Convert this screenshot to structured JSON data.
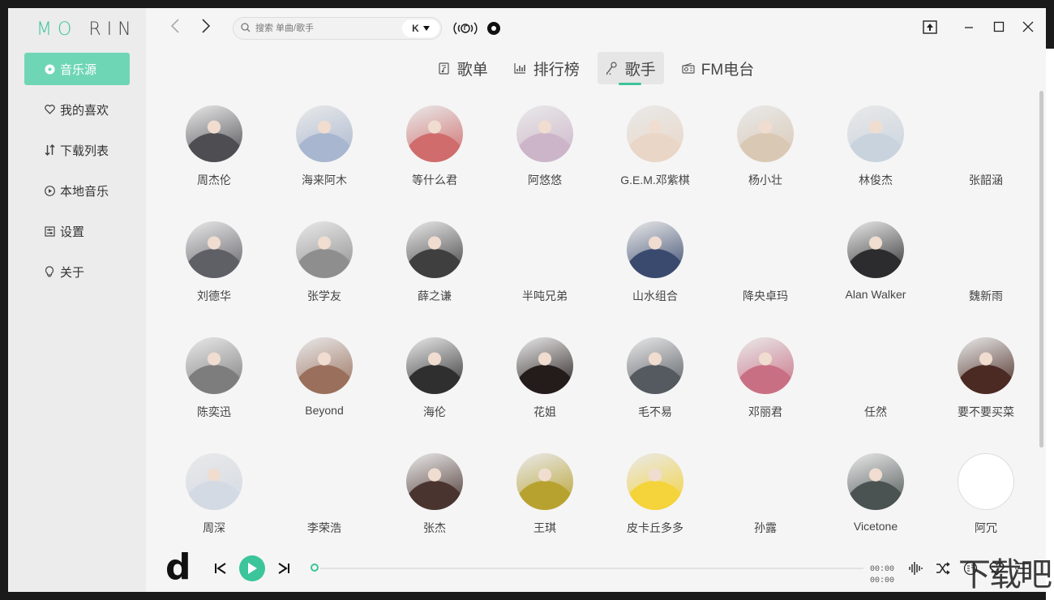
{
  "app": {
    "logo_left": "MO",
    "logo_right": "RIN"
  },
  "sidebar": {
    "items": [
      {
        "label": "音乐源",
        "icon": "disc-icon"
      },
      {
        "label": "我的喜欢",
        "icon": "heart-icon"
      },
      {
        "label": "下载列表",
        "icon": "sort-arrows-icon"
      },
      {
        "label": "本地音乐",
        "icon": "play-circle-icon"
      },
      {
        "label": "设置",
        "icon": "settings-icon"
      },
      {
        "label": "关于",
        "icon": "lightbulb-icon"
      }
    ]
  },
  "search": {
    "placeholder": "搜索 单曲/歌手",
    "source": "K"
  },
  "tabs": [
    {
      "label": "歌单",
      "icon": "playlist-icon"
    },
    {
      "label": "排行榜",
      "icon": "bar-chart-icon"
    },
    {
      "label": "歌手",
      "icon": "singer-icon"
    },
    {
      "label": "FM电台",
      "icon": "radio-icon"
    }
  ],
  "singers": [
    {
      "name": "周杰伦",
      "color": "#4d4d52",
      "has_avatar": true
    },
    {
      "name": "海来阿木",
      "color": "#a8b7cf",
      "has_avatar": true
    },
    {
      "name": "等什么君",
      "color": "#d06c6c",
      "has_avatar": true
    },
    {
      "name": "阿悠悠",
      "color": "#cdb5c9",
      "has_avatar": true
    },
    {
      "name": "G.E.M.邓紫棋",
      "color": "#e9d6c6",
      "has_avatar": true
    },
    {
      "name": "杨小壮",
      "color": "#d9c8b4",
      "has_avatar": true
    },
    {
      "name": "林俊杰",
      "color": "#c9d3de",
      "has_avatar": true
    },
    {
      "name": "张韶涵",
      "color": "",
      "has_avatar": false
    },
    {
      "name": "刘德华",
      "color": "#5f5f66",
      "has_avatar": true
    },
    {
      "name": "张学友",
      "color": "#8e8e8e",
      "has_avatar": true
    },
    {
      "name": "薛之谦",
      "color": "#3f3f3f",
      "has_avatar": true
    },
    {
      "name": "半吨兄弟",
      "color": "",
      "has_avatar": false
    },
    {
      "name": "山水组合",
      "color": "#3a4a6e",
      "has_avatar": true
    },
    {
      "name": "降央卓玛",
      "color": "",
      "has_avatar": false
    },
    {
      "name": "Alan Walker",
      "color": "#2c2c2e",
      "has_avatar": true
    },
    {
      "name": "魏新雨",
      "color": "",
      "has_avatar": false
    },
    {
      "name": "陈奕迅",
      "color": "#7d7d7d",
      "has_avatar": true
    },
    {
      "name": "Beyond",
      "color": "#9a6f5c",
      "has_avatar": true
    },
    {
      "name": "海伦",
      "color": "#2f2f2f",
      "has_avatar": true
    },
    {
      "name": "花姐",
      "color": "#241b1b",
      "has_avatar": true
    },
    {
      "name": "毛不易",
      "color": "#555a60",
      "has_avatar": true
    },
    {
      "name": "邓丽君",
      "color": "#c96f84",
      "has_avatar": true
    },
    {
      "name": "任然",
      "color": "",
      "has_avatar": false
    },
    {
      "name": "要不要买菜",
      "color": "#4a2a22",
      "has_avatar": true
    },
    {
      "name": "周深",
      "color": "#d4dae4",
      "has_avatar": true
    },
    {
      "name": "李荣浩",
      "color": "",
      "has_avatar": false
    },
    {
      "name": "张杰",
      "color": "#4a3430",
      "has_avatar": true
    },
    {
      "name": "王琪",
      "color": "#b8a22f",
      "has_avatar": true
    },
    {
      "name": "皮卡丘多多",
      "color": "#f5d33a",
      "has_avatar": true
    },
    {
      "name": "孙露",
      "color": "",
      "has_avatar": false
    },
    {
      "name": "Vicetone",
      "color": "#4b5352",
      "has_avatar": true
    },
    {
      "name": "阿冗",
      "color": "#ffffff",
      "has_avatar": true
    }
  ],
  "player": {
    "logo": "d",
    "current_time": "00:00",
    "total_time": "00:00",
    "progress": 0
  },
  "watermark": "下载吧",
  "colors": {
    "accent": "#3cc49a",
    "active_menu": "#6fd6b5"
  }
}
